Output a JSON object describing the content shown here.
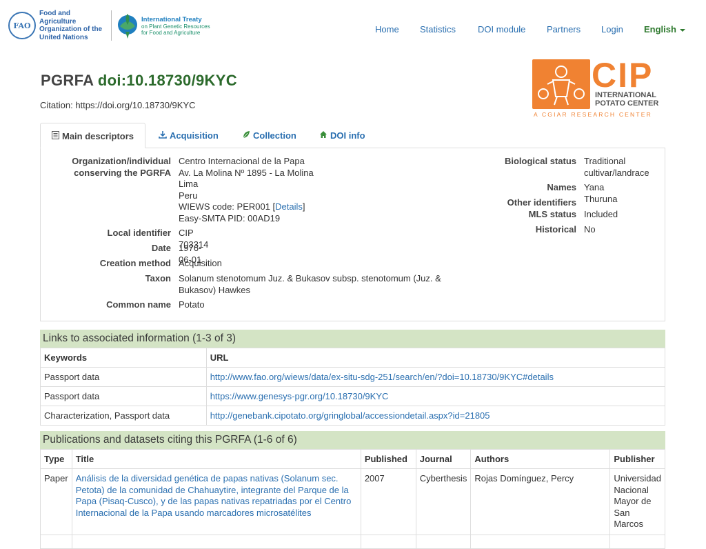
{
  "header": {
    "fao_text": [
      "Food and Agriculture",
      "Organization of the",
      "United Nations"
    ],
    "treaty_text": [
      "International Treaty",
      "on Plant Genetic Resources",
      "for Food and Agriculture"
    ],
    "nav": [
      "Home",
      "Statistics",
      "DOI module",
      "Partners",
      "Login"
    ],
    "language": "English"
  },
  "page": {
    "title_prefix": "PGRFA",
    "title_doi": "doi:10.18730/9KYC",
    "citation_label": "Citation:",
    "citation_url": "https://doi.org/10.18730/9KYC"
  },
  "cip_logo": {
    "letters": "CIP",
    "line1": "INTERNATIONAL",
    "line2": "POTATO CENTER",
    "tagline": "A CGIAR RESEARCH CENTER"
  },
  "tabs": [
    {
      "label": "Main descriptors",
      "icon": "list-icon"
    },
    {
      "label": "Acquisition",
      "icon": "download-icon"
    },
    {
      "label": "Collection",
      "icon": "leaf-icon"
    },
    {
      "label": "DOI info",
      "icon": "home-icon"
    }
  ],
  "descriptors": {
    "org_label_1": "Organization/individual",
    "org_label_2": "conserving the PGRFA",
    "org_lines": [
      "Centro Internacional de la Papa",
      "Av. La Molina Nº 1895 - La Molina",
      "Lima",
      "Peru"
    ],
    "wiews_prefix": "WIEWS code: PER001 [",
    "wiews_link": "Details",
    "wiews_suffix": "]",
    "smta": "Easy-SMTA PID: 00AD19",
    "local_id_label": "Local identifier",
    "local_id": "CIP 703314",
    "date_label": "Date",
    "date": "1976-06-01",
    "method_label": "Creation method",
    "method": "Acquisition",
    "taxon_label": "Taxon",
    "taxon_1": "Solanum stenotomum Juz. & Bukasov subsp. stenotomum (Juz. &",
    "taxon_2": "Bukasov) Hawkes",
    "common_label": "Common name",
    "common": "Potato",
    "bio_label": "Biological status",
    "bio_1": "Traditional",
    "bio_2": "cultivar/landrace",
    "names_label": "Names",
    "names": "Yana Thuruna",
    "other_label": "Other identifiers",
    "mls_label": "MLS status",
    "mls": "Included",
    "hist_label": "Historical",
    "hist": "No"
  },
  "links": {
    "heading": "Links to associated information (1-3 of 3)",
    "col_keywords": "Keywords",
    "col_url": "URL",
    "rows": [
      {
        "keywords": "Passport data",
        "url": "http://www.fao.org/wiews/data/ex-situ-sdg-251/search/en/?doi=10.18730/9KYC#details"
      },
      {
        "keywords": "Passport data",
        "url": "https://www.genesys-pgr.org/10.18730/9KYC"
      },
      {
        "keywords": "Characterization, Passport data",
        "url": "http://genebank.cipotato.org/gringlobal/accessiondetail.aspx?id=21805"
      }
    ]
  },
  "publications": {
    "heading": "Publications and datasets citing this PGRFA (1-6 of 6)",
    "cols": [
      "Type",
      "Title",
      "Published",
      "Journal",
      "Authors",
      "Publisher"
    ],
    "rows": [
      {
        "type": "Paper",
        "title": "Análisis de la diversidad genética de papas nativas (Solanum sec. Petota) de la comunidad de Chahuaytire, integrante del Parque de la Papa (Pisaq-Cusco), y de las papas nativas repatriadas por el Centro Internacional de la Papa usando marcadores microsatélites",
        "published": "2007",
        "journal": "Cyberthesis",
        "authors": "Rojas Domínguez, Percy",
        "publisher": "Universidad Nacional Mayor de San Marcos"
      }
    ]
  }
}
